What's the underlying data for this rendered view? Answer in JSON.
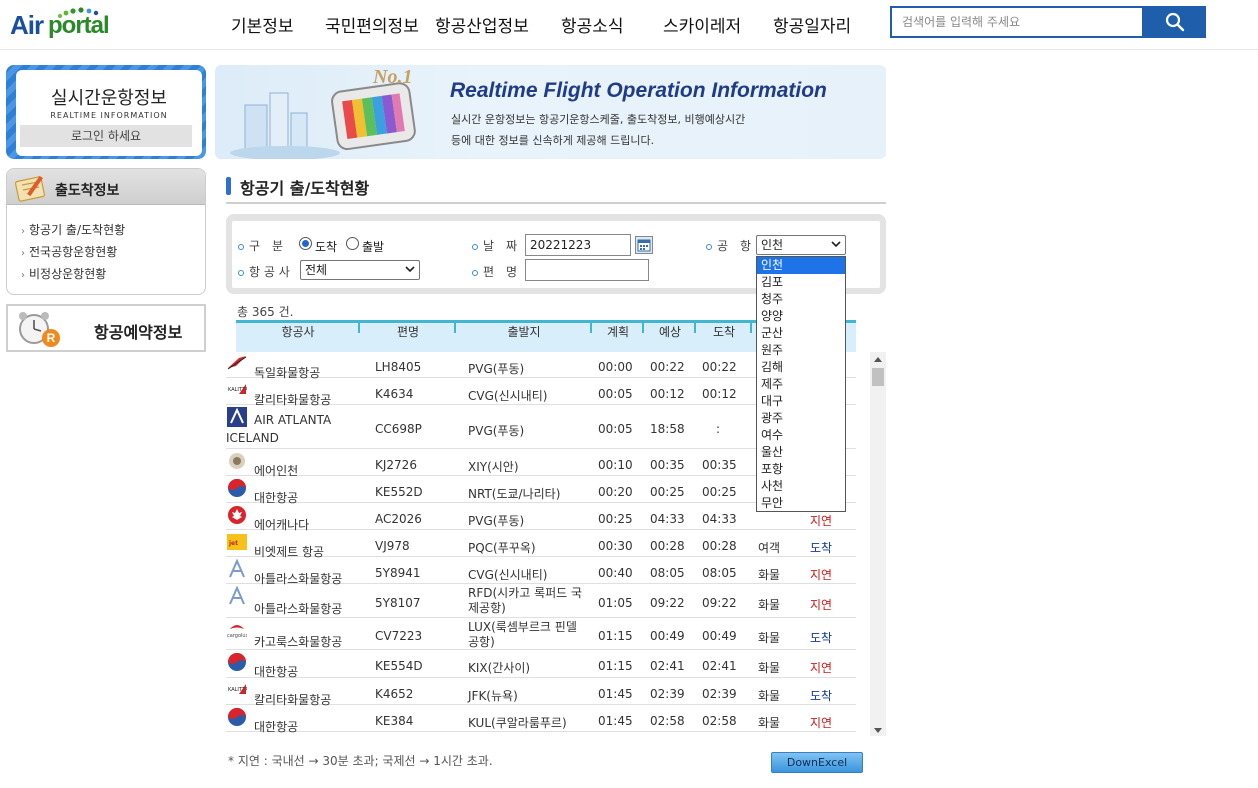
{
  "header": {
    "logo_air": "Air",
    "logo_portal": "portal",
    "nav": [
      "기본정보",
      "국민편의정보",
      "항공산업정보",
      "항공소식",
      "스카이레저",
      "항공일자리"
    ],
    "search_placeholder": "검색어를 입력해 주세요"
  },
  "sidebar": {
    "realtime_title": "실시간운항정보",
    "realtime_sub": "REALTIME INFORMATION",
    "login": "로그인 하세요",
    "menu_title": "출도착정보",
    "menu_items": [
      "항공기 출/도착현황",
      "전국공항운항현황",
      "비정상운항현황"
    ],
    "reserve_label": "항공예약정보"
  },
  "banner": {
    "title": "Realtime Flight Operation Information",
    "desc1": "실시간 운항정보는 항공기운항스케줄, 출도착정보, 비행예상시간",
    "desc2": "등에 대한 정보를 신속하게 제공해 드립니다."
  },
  "page_title": "항공기 출/도착현황",
  "filters": {
    "type_label": "구　분",
    "type_options": [
      "도착",
      "출발"
    ],
    "date_label": "날　짜",
    "date_value": "20221223",
    "airport_label": "공　항",
    "airport_value": "인천",
    "airline_label": "항 공 사",
    "airline_value": "전체",
    "flight_label": "편　명",
    "flight_value": ""
  },
  "airport_options": [
    "인천",
    "김포",
    "청주",
    "양양",
    "군산",
    "원주",
    "김해",
    "제주",
    "대구",
    "광주",
    "여수",
    "울산",
    "포항",
    "사천",
    "무안"
  ],
  "table": {
    "total": "총 365 건.",
    "headers": [
      "항공사",
      "편명",
      "출발지",
      "계획",
      "예상",
      "도착"
    ],
    "rows": [
      {
        "airline": "독일화물항공",
        "flight": "LH8405",
        "origin": "PVG(푸동)",
        "plan": "00:00",
        "est": "00:22",
        "arr": "00:22",
        "kind": "",
        "status": "",
        "logo": "lufthansa-cargo"
      },
      {
        "airline": "칼리타화물항공",
        "flight": "K4634",
        "origin": "CVG(신시내티)",
        "plan": "00:05",
        "est": "00:12",
        "arr": "00:12",
        "kind": "",
        "status": "",
        "logo": "kalitta"
      },
      {
        "airline": "AIR ATLANTA ICELAND",
        "flight": "CC698P",
        "origin": "PVG(푸동)",
        "plan": "00:05",
        "est": "18:58",
        "arr": ":",
        "kind": "",
        "status": "",
        "logo": "air-atlanta"
      },
      {
        "airline": "에어인천",
        "flight": "KJ2726",
        "origin": "XIY(시안)",
        "plan": "00:10",
        "est": "00:35",
        "arr": "00:35",
        "kind": "",
        "status": "",
        "logo": "air-incheon"
      },
      {
        "airline": "대한항공",
        "flight": "KE552D",
        "origin": "NRT(도쿄/나리타)",
        "plan": "00:20",
        "est": "00:25",
        "arr": "00:25",
        "kind": "",
        "status": "",
        "logo": "korean-air"
      },
      {
        "airline": "에어캐나다",
        "flight": "AC2026",
        "origin": "PVG(푸동)",
        "plan": "00:25",
        "est": "04:33",
        "arr": "04:33",
        "kind": "",
        "status": "지연",
        "logo": "air-canada"
      },
      {
        "airline": "비엣제트 항공",
        "flight": "VJ978",
        "origin": "PQC(푸꾸옥)",
        "plan": "00:30",
        "est": "00:28",
        "arr": "00:28",
        "kind": "여객",
        "status": "도착",
        "logo": "vietjet"
      },
      {
        "airline": "아틀라스화물항공",
        "flight": "5Y8941",
        "origin": "CVG(신시내티)",
        "plan": "00:40",
        "est": "08:05",
        "arr": "08:05",
        "kind": "화물",
        "status": "지연",
        "logo": "atlas"
      },
      {
        "airline": "아틀라스화물항공",
        "flight": "5Y8107",
        "origin": "RFD(시카고 록퍼드 국제공항)",
        "plan": "01:05",
        "est": "09:22",
        "arr": "09:22",
        "kind": "화물",
        "status": "지연",
        "logo": "atlas"
      },
      {
        "airline": "카고룩스화물항공",
        "flight": "CV7223",
        "origin": "LUX(룩셈부르크 핀델 공항)",
        "plan": "01:15",
        "est": "00:49",
        "arr": "00:49",
        "kind": "화물",
        "status": "도착",
        "logo": "cargolux"
      },
      {
        "airline": "대한항공",
        "flight": "KE554D",
        "origin": "KIX(간사이)",
        "plan": "01:15",
        "est": "02:41",
        "arr": "02:41",
        "kind": "화물",
        "status": "지연",
        "logo": "korean-air"
      },
      {
        "airline": "칼리타화물항공",
        "flight": "K4652",
        "origin": "JFK(뉴욕)",
        "plan": "01:45",
        "est": "02:39",
        "arr": "02:39",
        "kind": "화물",
        "status": "도착",
        "logo": "kalitta"
      },
      {
        "airline": "대한항공",
        "flight": "KE384",
        "origin": "KUL(쿠알라룸푸르)",
        "plan": "01:45",
        "est": "02:58",
        "arr": "02:58",
        "kind": "화물",
        "status": "지연",
        "logo": "korean-air"
      }
    ]
  },
  "footnote": "* 지연 : 국내선 → 30분 초과; 국제선 → 1시간 초과.",
  "excel_button": "DownExcel",
  "colors": {
    "accent": "#1e5eaa",
    "header_line": "#41b6d0",
    "delay": "#d01818",
    "arrived": "#123a9a",
    "dropdown_sel": "#1e73e8"
  }
}
